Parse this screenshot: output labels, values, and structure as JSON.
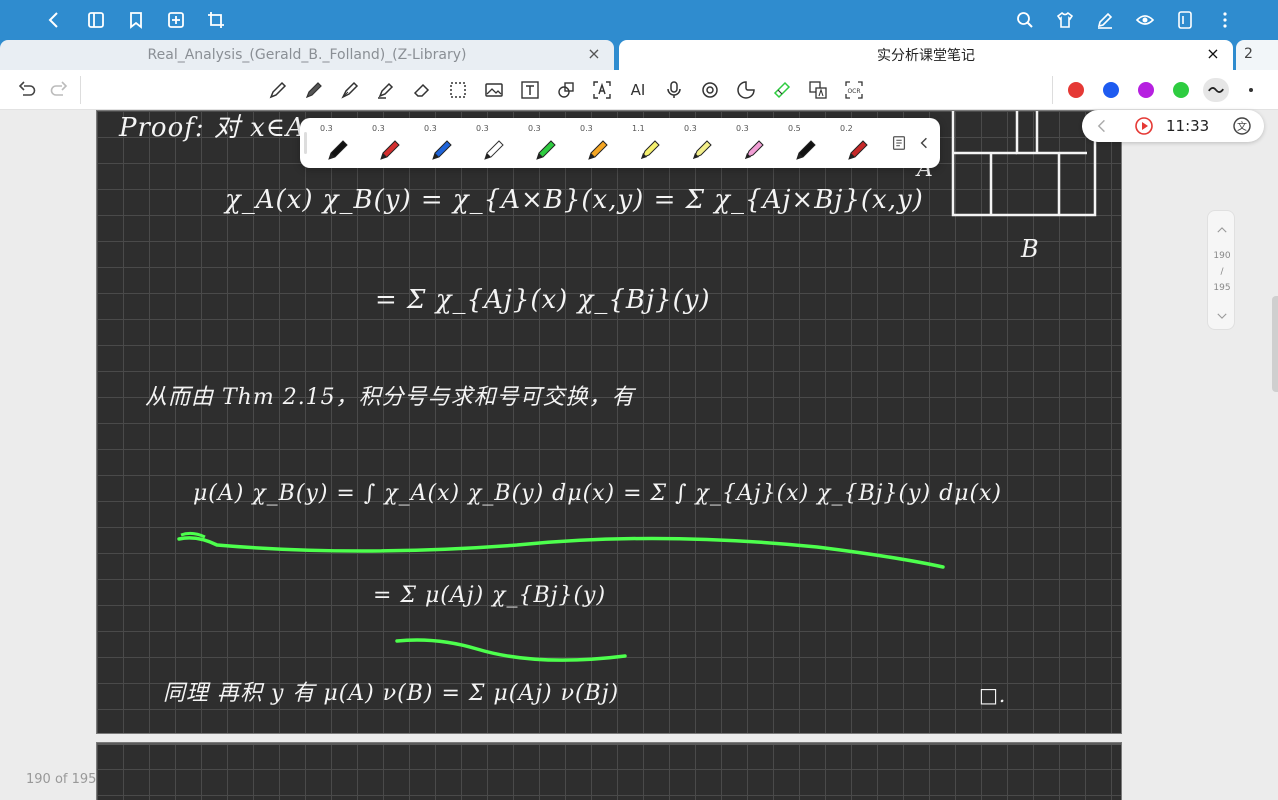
{
  "tabs": {
    "tab1_label": "Real_Analysis_(Gerald_B._Folland)_(Z-Library)",
    "tab2_label": "实分析课堂笔记",
    "close_glyph": "×",
    "tab_count": "2"
  },
  "toolbar": {
    "ai_label": "AI",
    "ocr_label": "OCR"
  },
  "colors": {
    "top_bar": "#2f8ccf",
    "red": "#e53935",
    "blue": "#1e5bf0",
    "purple": "#b620e0",
    "green": "#2ecc40",
    "highlight_green": "#4dff4d",
    "page_bg": "#2e2e2e"
  },
  "palette": {
    "pens": [
      {
        "width": "0.3",
        "color": "#111111",
        "type": "pen"
      },
      {
        "width": "0.3",
        "color": "#d32f2f",
        "type": "pen"
      },
      {
        "width": "0.3",
        "color": "#1e63d8",
        "type": "pen"
      },
      {
        "width": "0.3",
        "color": "#ffffff",
        "type": "pen"
      },
      {
        "width": "0.3",
        "color": "#2ecc40",
        "type": "pen"
      },
      {
        "width": "0.3",
        "color": "#f5a623",
        "type": "pen"
      },
      {
        "width": "1.1",
        "color": "#f5f06e",
        "type": "highlighter"
      },
      {
        "width": "0.3",
        "color": "#f3ef8a",
        "type": "highlighter"
      },
      {
        "width": "0.3",
        "color": "#f29fd6",
        "type": "highlighter"
      },
      {
        "width": "0.5",
        "color": "#111111",
        "type": "pen"
      },
      {
        "width": "0.2",
        "color": "#c62828",
        "type": "pen"
      }
    ]
  },
  "timer": {
    "time": "11:33"
  },
  "scroller": {
    "current": "190",
    "sep": "/",
    "total": "195"
  },
  "footer": {
    "page_counter": "190 of 195"
  },
  "notes": {
    "line1": "Proof:  对 x∈A",
    "line2": "χ_A(x) χ_B(y) = χ_{A×B}(x,y) = Σ χ_{Aj×Bj}(x,y)",
    "line3": "= Σ χ_{Aj}(x) χ_{Bj}(y)",
    "line4": "从而由 Thm 2.15，积分号与求和号可交换，有",
    "line5": "μ(A) χ_B(y) = ∫ χ_A(x) χ_B(y) dμ(x) = Σ ∫ χ_{Aj}(x) χ_{Bj}(y) dμ(x)",
    "line6": "= Σ μ(Aj) χ_{Bj}(y)",
    "line7": "同理 再积 y 有   μ(A) ν(B) = Σ μ(Aj) ν(Bj)",
    "qed": "□.",
    "label_A": "A",
    "label_B": "B"
  }
}
